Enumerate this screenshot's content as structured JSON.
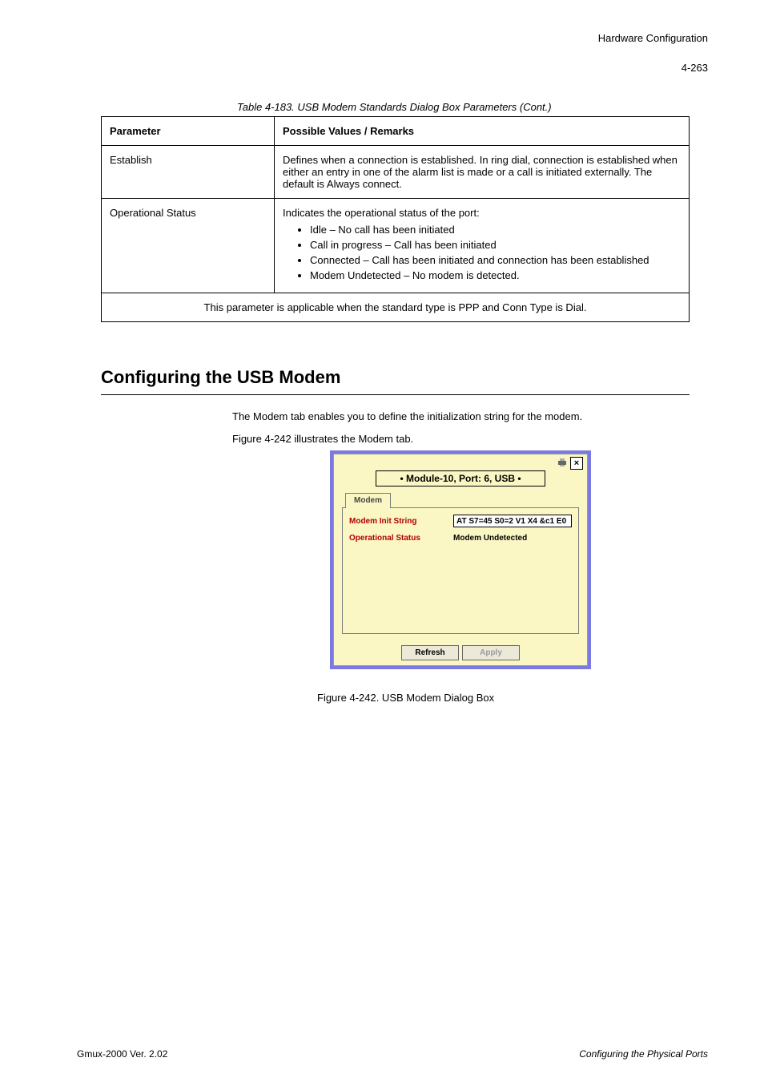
{
  "header": {
    "right_title": "Hardware Configuration",
    "page_number": "4-263"
  },
  "table": {
    "caption": "Table 4-183. USB Modem Standards Dialog Box Parameters (Cont.)",
    "headers": [
      "Parameter",
      "Possible Values / Remarks"
    ],
    "rows": [
      {
        "param": "Establish",
        "desc": "Defines when a connection is established. In ring dial, connection is established when either an entry in one of the alarm list is made or a call is initiated externally. The default is Always connect."
      },
      {
        "param": "Operational Status",
        "desc_intro": "Indicates the operational status of the port:",
        "bullets": [
          "Idle – No call has been initiated",
          "Call in progress – Call has been initiated",
          "Connected – Call has been initiated and connection has been established",
          "Modem Undetected – No modem is detected."
        ]
      }
    ],
    "footer": "This parameter is applicable when the standard type is PPP and Conn Type is Dial."
  },
  "section": {
    "title": "Configuring the USB Modem",
    "line1": "The Modem tab enables you to define the initialization string for the modem.",
    "line2": "Figure 4-242 illustrates the Modem tab."
  },
  "figure": {
    "caption": "Figure 4-242. USB Modem Dialog Box"
  },
  "dialog": {
    "title": "• Module-10, Port: 6, USB •",
    "tab": "Modem",
    "fields": {
      "init_label": "Modem Init String",
      "init_value": "AT S7=45 S0=2 V1 X4 &c1 E0",
      "status_label": "Operational Status",
      "status_value": "Modem Undetected"
    },
    "buttons": {
      "refresh": "Refresh",
      "apply": "Apply"
    }
  },
  "footer": {
    "left": "Gmux-2000 Ver. 2.02",
    "right": "Configuring the Physical Ports"
  }
}
